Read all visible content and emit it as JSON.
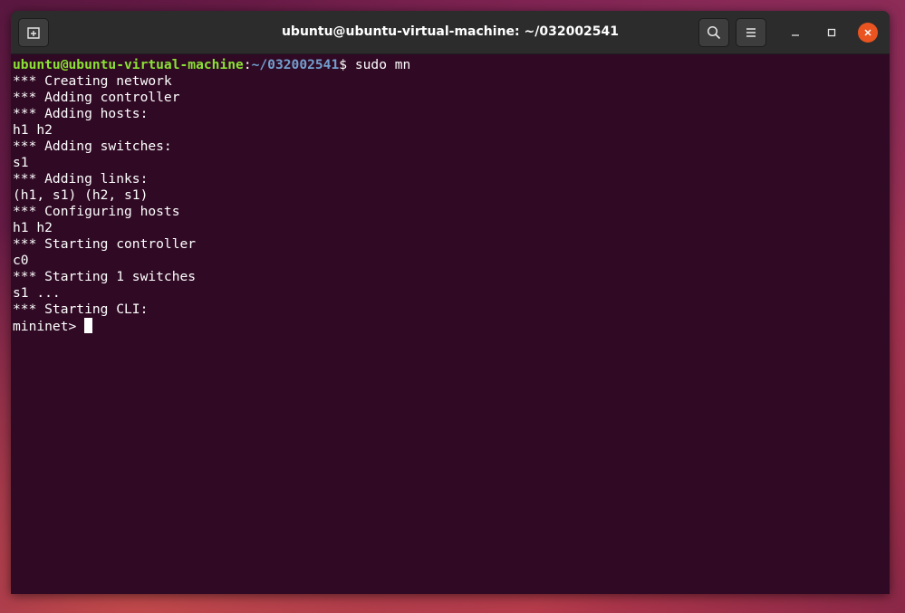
{
  "window": {
    "title": "ubuntu@ubuntu-virtual-machine: ~/032002541"
  },
  "titlebar": {
    "new_tab_icon": "new-tab-icon",
    "search_icon": "search-icon",
    "menu_icon": "hamburger-menu-icon",
    "minimize_icon": "minimize-icon",
    "maximize_icon": "maximize-icon",
    "close_icon": "close-icon"
  },
  "terminal": {
    "prompt_user": "ubuntu@ubuntu-virtual-machine",
    "prompt_sep": ":",
    "prompt_path": "~/032002541",
    "prompt_symbol": "$ ",
    "command": "sudo mn",
    "output": [
      "*** Creating network",
      "*** Adding controller",
      "*** Adding hosts:",
      "h1 h2",
      "*** Adding switches:",
      "s1",
      "*** Adding links:",
      "(h1, s1) (h2, s1)",
      "*** Configuring hosts",
      "h1 h2",
      "*** Starting controller",
      "c0",
      "*** Starting 1 switches",
      "s1 ...",
      "*** Starting CLI:"
    ],
    "cli_prompt": "mininet> "
  },
  "colors": {
    "terminal_bg": "#300a24",
    "prompt_user": "#8ae234",
    "prompt_path": "#729fcf",
    "titlebar_bg": "#2c2c2c",
    "close_button": "#e95420"
  }
}
